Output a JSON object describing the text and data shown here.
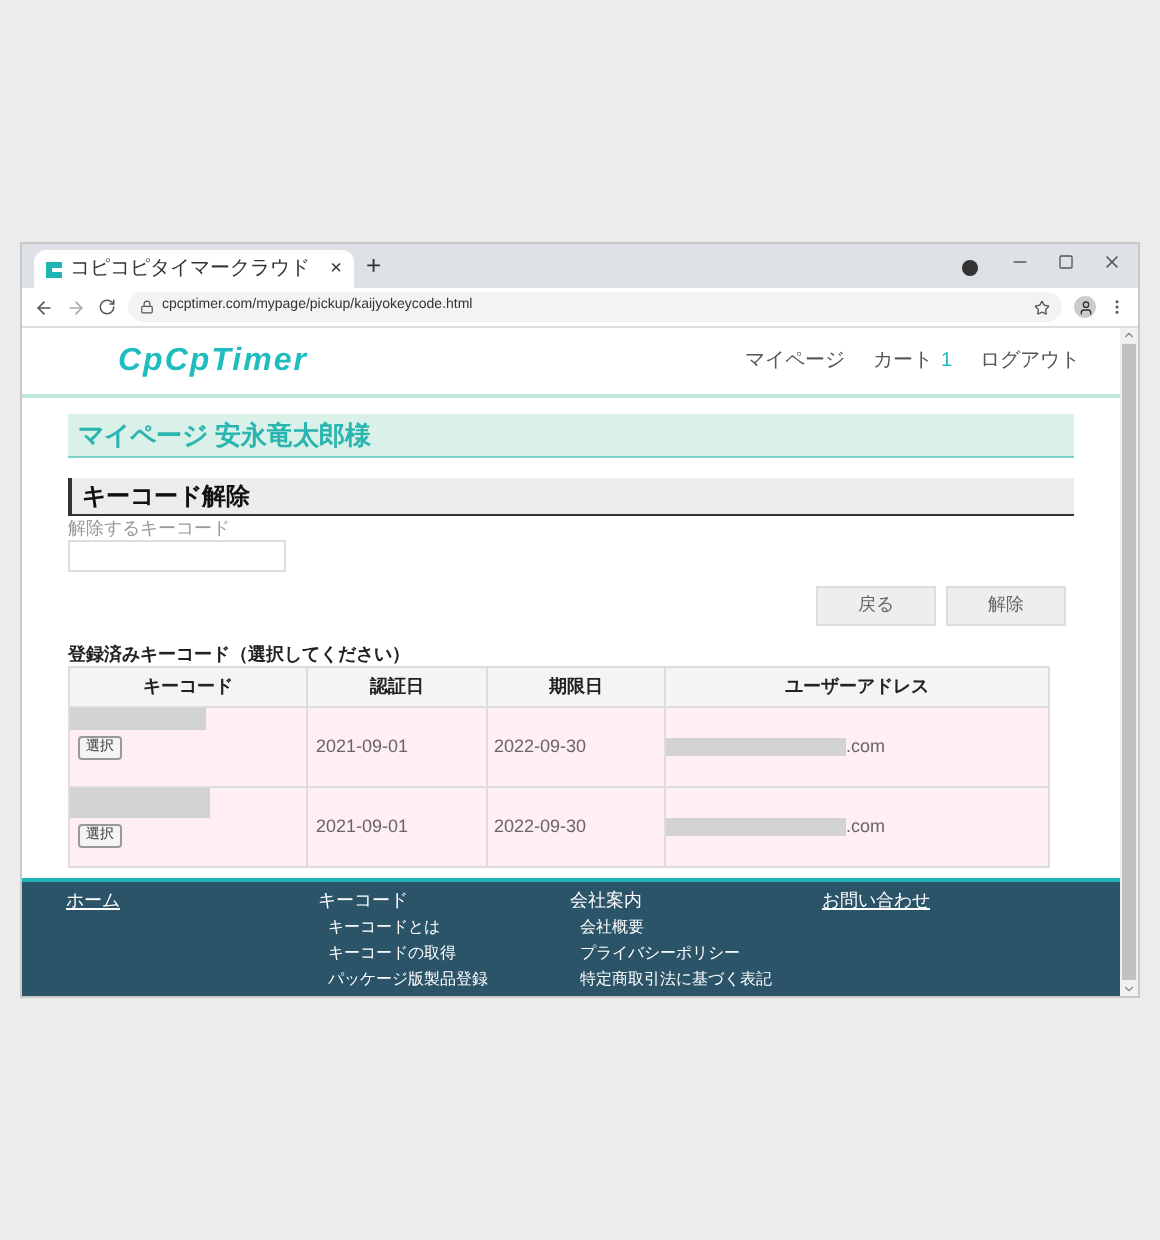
{
  "browser": {
    "tab_title": "コピコピタイマークラウド",
    "tab_close": "×",
    "new_tab": "+",
    "url": "cpcptimer.com/mypage/pickup/kaijyokeycode.html"
  },
  "header": {
    "logo": "CpCpTimer",
    "nav": [
      {
        "label": "マイページ"
      },
      {
        "label": "カート",
        "badge": "1"
      },
      {
        "label": "ログアウト"
      }
    ]
  },
  "page_title": "マイページ 安永竜太郎様",
  "section_title": "キーコード解除",
  "form": {
    "label": "解除するキーコード"
  },
  "buttons": [
    "戻る",
    "解除"
  ],
  "table": {
    "caption": "登録済みキーコード（選択してください）",
    "columns": [
      "キーコード",
      "認証日",
      "期限日",
      "ユーザーアドレス"
    ],
    "rows": [
      {
        "select": "選択",
        "auth_date": "2021-09-01",
        "expiry": "2022-09-30",
        "address_suffix": ".com"
      },
      {
        "select": "選択",
        "auth_date": "2021-09-01",
        "expiry": "2022-09-30",
        "address_suffix": ".com"
      }
    ]
  },
  "footer": [
    {
      "heading": "ホーム",
      "kind": "link"
    },
    {
      "heading": "キーコード",
      "kind": "heading",
      "links": [
        "キーコードとは",
        "キーコードの取得",
        "パッケージ版製品登録"
      ]
    },
    {
      "heading": "会社案内",
      "kind": "heading",
      "links": [
        "会社概要",
        "プライバシーポリシー",
        "特定商取引法に基づく表記"
      ]
    },
    {
      "heading": "お問い合わせ",
      "kind": "link"
    }
  ]
}
